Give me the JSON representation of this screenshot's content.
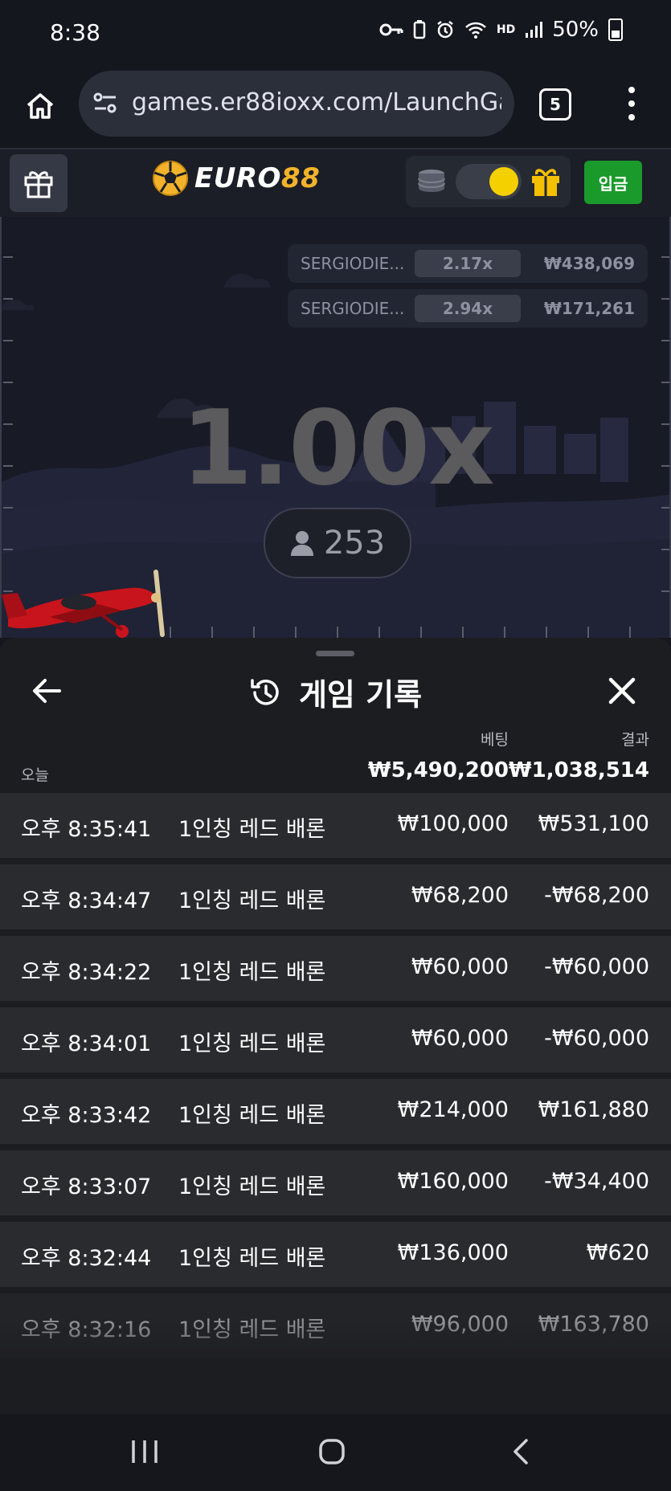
{
  "status_bar": {
    "time": "8:38",
    "network": "HD",
    "battery": "50%"
  },
  "browser": {
    "url": "games.er88ioxx.com/LaunchGa",
    "tab_count": "5"
  },
  "site": {
    "logo_euro": "EURO",
    "logo_num": "88",
    "deposit_label": "입금",
    "colors": {
      "brand_gold": "#f2b32b",
      "deposit_green": "#1b9a2c",
      "toggle_yellow": "#f5d000"
    }
  },
  "game": {
    "recent_bets": [
      {
        "name": "SERGIODIE...",
        "multiplier": "2.17x",
        "amount": "₩438,069"
      },
      {
        "name": "SERGIODIE...",
        "multiplier": "2.94x",
        "amount": "₩171,261"
      }
    ],
    "multiplier": "1.00x",
    "player_count": "253"
  },
  "history": {
    "title": "게임 기록",
    "col_bet": "베팅",
    "col_result": "결과",
    "today_label": "오늘",
    "total_bet": "₩5,490,200",
    "total_result": "₩1,038,514",
    "rows": [
      {
        "time": "오후 8:35:41",
        "game": "1인칭 레드 배론",
        "bet": "₩100,000",
        "result": "₩531,100"
      },
      {
        "time": "오후 8:34:47",
        "game": "1인칭 레드 배론",
        "bet": "₩68,200",
        "result": "-₩68,200"
      },
      {
        "time": "오후 8:34:22",
        "game": "1인칭 레드 배론",
        "bet": "₩60,000",
        "result": "-₩60,000"
      },
      {
        "time": "오후 8:34:01",
        "game": "1인칭 레드 배론",
        "bet": "₩60,000",
        "result": "-₩60,000"
      },
      {
        "time": "오후 8:33:42",
        "game": "1인칭 레드 배론",
        "bet": "₩214,000",
        "result": "₩161,880"
      },
      {
        "time": "오후 8:33:07",
        "game": "1인칭 레드 배론",
        "bet": "₩160,000",
        "result": "-₩34,400"
      },
      {
        "time": "오후 8:32:44",
        "game": "1인칭 레드 배론",
        "bet": "₩136,000",
        "result": "₩620"
      },
      {
        "time": "오후 8:32:16",
        "game": "1인칭 레드 배론",
        "bet": "₩96,000",
        "result": "₩163,780"
      }
    ]
  }
}
